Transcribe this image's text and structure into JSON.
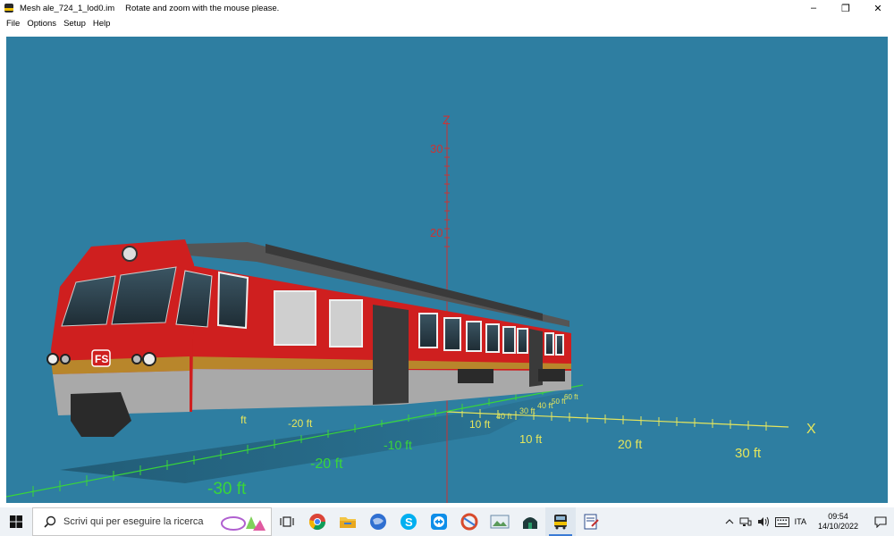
{
  "window": {
    "title": "Mesh ale_724_1_lod0.im",
    "hint": "Rotate and zoom with the mouse please.",
    "minimize": "–",
    "restore": "❐",
    "close": "✕"
  },
  "menu": {
    "items": [
      "File",
      "Options",
      "Setup",
      "Help"
    ]
  },
  "viewport": {
    "background": "#2e7ea1",
    "axes": {
      "z_label": "Z",
      "x_label": "X",
      "z_ticks": [
        "30",
        "20"
      ],
      "x_ticks": [
        "10 ft",
        "10 ft",
        "20 ft",
        "30 ft"
      ],
      "y_ticks": [
        "-10 ft",
        "-20 ft",
        "-30 ft",
        "-20 ft",
        "ft"
      ],
      "near_ticks": [
        "30 ft",
        "40 ft",
        "50 ft",
        "60 ft",
        "40 ft"
      ]
    },
    "train": {
      "logo": "FS",
      "body_color": "#cf1f1f",
      "stripe_color": "#b8862b",
      "skirt_color": "#a9a9a9"
    },
    "colors": {
      "x_axis": "#e6e65c",
      "y_axis": "#39d639",
      "z_axis": "#cc3333"
    }
  },
  "taskbar": {
    "search_placeholder": "Scrivi qui per eseguire la ricerca",
    "apps": [
      {
        "name": "task-view-icon"
      },
      {
        "name": "chrome-icon"
      },
      {
        "name": "file-explorer-icon"
      },
      {
        "name": "browser-globe-icon"
      },
      {
        "name": "skype-icon"
      },
      {
        "name": "teamviewer-icon"
      },
      {
        "name": "ccleaner-icon"
      },
      {
        "name": "image-viewer-icon"
      },
      {
        "name": "game-icon"
      },
      {
        "name": "train-app-icon"
      },
      {
        "name": "editor-icon"
      }
    ],
    "tray": {
      "language": "ITA",
      "time": "09:54",
      "date": "14/10/2022"
    }
  }
}
